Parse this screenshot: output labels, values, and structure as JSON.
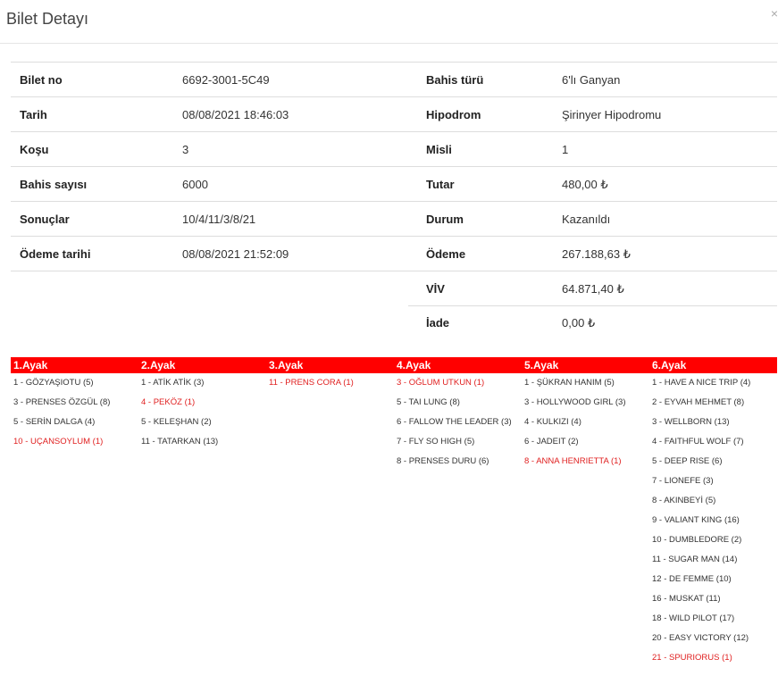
{
  "modal": {
    "title": "Bilet Detayı",
    "close": "×"
  },
  "info": {
    "rows": [
      {
        "l1": "Bilet no",
        "v1": "6692-3001-5C49",
        "l2": "Bahis türü",
        "v2": "6'lı Ganyan"
      },
      {
        "l1": "Tarih",
        "v1": "08/08/2021 18:46:03",
        "l2": "Hipodrom",
        "v2": "Şirinyer Hipodromu"
      },
      {
        "l1": "Koşu",
        "v1": "3",
        "l2": "Misli",
        "v2": "1"
      },
      {
        "l1": "Bahis sayısı",
        "v1": "6000",
        "l2": "Tutar",
        "v2": "480,00 ₺"
      },
      {
        "l1": "Sonuçlar",
        "v1": "10/4/11/3/8/21",
        "l2": "Durum",
        "v2": "Kazanıldı"
      },
      {
        "l1": "Ödeme tarihi",
        "v1": "08/08/2021 21:52:09",
        "l2": "Ödeme",
        "v2": "267.188,63 ₺"
      },
      {
        "l1": "",
        "v1": "",
        "l2": "VİV",
        "v2": "64.871,40 ₺"
      },
      {
        "l1": "",
        "v1": "",
        "l2": "İade",
        "v2": "0,00 ₺"
      }
    ]
  },
  "legs": [
    {
      "title": "1.Ayak",
      "items": [
        {
          "text": "1 - GÖZYAŞIOTU (5)",
          "win": false
        },
        {
          "text": "3 - PRENSES ÖZGÜL (8)",
          "win": false
        },
        {
          "text": "5 - SERİN DALGA (4)",
          "win": false
        },
        {
          "text": "10 - UÇANSOYLUM (1)",
          "win": true
        }
      ]
    },
    {
      "title": "2.Ayak",
      "items": [
        {
          "text": "1 - ATİK ATİK (3)",
          "win": false
        },
        {
          "text": "4 - PEKÖZ (1)",
          "win": true
        },
        {
          "text": "5 - KELEŞHAN (2)",
          "win": false
        },
        {
          "text": "11 - TATARKAN (13)",
          "win": false
        }
      ]
    },
    {
      "title": "3.Ayak",
      "items": [
        {
          "text": "11 - PRENS CORA (1)",
          "win": true
        }
      ]
    },
    {
      "title": "4.Ayak",
      "items": [
        {
          "text": "3 - OĞLUM UTKUN (1)",
          "win": true
        },
        {
          "text": "5 - TAI LUNG (8)",
          "win": false
        },
        {
          "text": "6 - FALLOW THE LEADER (3)",
          "win": false
        },
        {
          "text": "7 - FLY SO HIGH (5)",
          "win": false
        },
        {
          "text": "8 - PRENSES DURU (6)",
          "win": false
        }
      ]
    },
    {
      "title": "5.Ayak",
      "items": [
        {
          "text": "1 - ŞÜKRAN HANIM (5)",
          "win": false
        },
        {
          "text": "3 - HOLLYWOOD GIRL (3)",
          "win": false
        },
        {
          "text": "4 - KULKIZI (4)",
          "win": false
        },
        {
          "text": "6 - JADEIT (2)",
          "win": false
        },
        {
          "text": "8 - ANNA HENRIETTA (1)",
          "win": true
        }
      ]
    },
    {
      "title": "6.Ayak",
      "items": [
        {
          "text": "1 - HAVE A NICE TRIP (4)",
          "win": false
        },
        {
          "text": "2 - EYVAH MEHMET (8)",
          "win": false
        },
        {
          "text": "3 - WELLBORN (13)",
          "win": false
        },
        {
          "text": "4 - FAITHFUL WOLF (7)",
          "win": false
        },
        {
          "text": "5 - DEEP RISE (6)",
          "win": false
        },
        {
          "text": "7 - LIONEFE (3)",
          "win": false
        },
        {
          "text": "8 - AKINBEYİ (5)",
          "win": false
        },
        {
          "text": "9 - VALIANT KING (16)",
          "win": false
        },
        {
          "text": "10 - DUMBLEDORE (2)",
          "win": false
        },
        {
          "text": "11 - SUGAR MAN (14)",
          "win": false
        },
        {
          "text": "12 - DE FEMME (10)",
          "win": false
        },
        {
          "text": "16 - MUSKAT (11)",
          "win": false
        },
        {
          "text": "18 - WILD PILOT (17)",
          "win": false
        },
        {
          "text": "20 - EASY VICTORY (12)",
          "win": false
        },
        {
          "text": "21 - SPURIORUS (1)",
          "win": true
        }
      ]
    }
  ],
  "colors": {
    "accent": "#ff0000",
    "win": "#e02020"
  }
}
